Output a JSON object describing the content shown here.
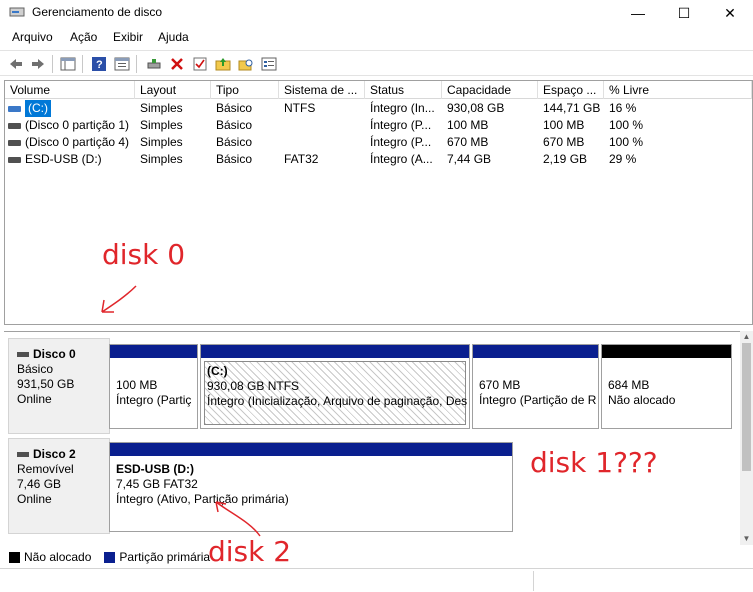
{
  "window": {
    "title": "Gerenciamento de disco",
    "minimize": "—",
    "maximize": "☐",
    "close": "✕"
  },
  "menu": [
    "Arquivo",
    "Ação",
    "Exibir",
    "Ajuda"
  ],
  "volume_table": {
    "columns": [
      "Volume",
      "Layout",
      "Tipo",
      "Sistema de ...",
      "Status",
      "Capacidade",
      "Espaço ...",
      "% Livre"
    ],
    "rows": [
      {
        "volume": "(C:)",
        "layout": "Simples",
        "tipo": "Básico",
        "fs": "NTFS",
        "status": "Íntegro (In...",
        "capacity": "930,08 GB",
        "free": "144,71 GB",
        "pct": "16 %"
      },
      {
        "volume": "(Disco 0 partição 1)",
        "layout": "Simples",
        "tipo": "Básico",
        "fs": "",
        "status": "Íntegro (P...",
        "capacity": "100 MB",
        "free": "100 MB",
        "pct": "100 %"
      },
      {
        "volume": "(Disco 0 partição 4)",
        "layout": "Simples",
        "tipo": "Básico",
        "fs": "",
        "status": "Íntegro (P...",
        "capacity": "670 MB",
        "free": "670 MB",
        "pct": "100 %"
      },
      {
        "volume": "ESD-USB (D:)",
        "layout": "Simples",
        "tipo": "Básico",
        "fs": "FAT32",
        "status": "Íntegro (A...",
        "capacity": "7,44 GB",
        "free": "2,19 GB",
        "pct": "29 %"
      }
    ]
  },
  "annotations": {
    "disk0": "disk 0",
    "disk1": "disk 1???",
    "disk2": "disk 2"
  },
  "disks": [
    {
      "name": "Disco 0",
      "type": "Básico",
      "size": "931,50 GB",
      "status": "Online",
      "partitions": [
        {
          "line1": "",
          "line2": "100 MB",
          "line3": "Íntegro (Partiç"
        },
        {
          "line1": "(C:)",
          "line2": "930,08 GB NTFS",
          "line3": "Íntegro (Inicialização, Arquivo de paginação, Des"
        },
        {
          "line1": "",
          "line2": "670 MB",
          "line3": "Íntegro (Partição de R"
        },
        {
          "line1": "",
          "line2": "684 MB",
          "line3": "Não alocado"
        }
      ]
    },
    {
      "name": "Disco 2",
      "type": "Removível",
      "size": "7,46 GB",
      "status": "Online",
      "partitions": [
        {
          "line1": "ESD-USB  (D:)",
          "line2": "7,45 GB FAT32",
          "line3": "Íntegro (Ativo, Partição primária)"
        }
      ]
    }
  ],
  "legend": {
    "unallocated": "Não alocado",
    "primary": "Partição primária",
    "colors": {
      "unallocated": "#000000",
      "primary": "#0a1f8f"
    }
  }
}
